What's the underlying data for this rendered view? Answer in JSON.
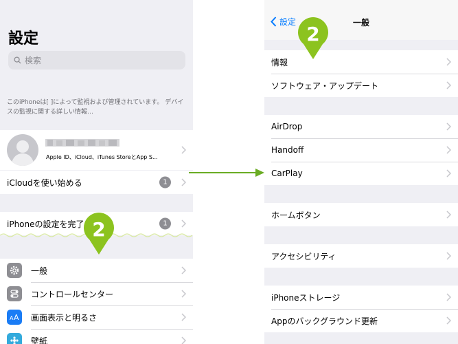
{
  "left": {
    "title": "設定",
    "search_placeholder": "検索",
    "notice": "このiPhoneは[ ]によって監視および管理されています。 デバイスの監視に関する詳しい情報…",
    "profile_subtitle": "Apple ID、iCloud、iTunes StoreとApp S...",
    "icloud_row": {
      "label": "iCloudを使い始める",
      "badge": "1"
    },
    "setup_row": {
      "label": "iPhoneの設定を完了",
      "badge": "1"
    },
    "menu_items": [
      {
        "label": "一般",
        "icon": "gear-icon"
      },
      {
        "label": "コントロールセンター",
        "icon": "control-center-icon"
      },
      {
        "label": "画面表示と明るさ",
        "icon": "display-brightness-icon"
      },
      {
        "label": "壁紙",
        "icon": "wallpaper-icon"
      }
    ]
  },
  "right": {
    "back_label": "設定",
    "title": "一般",
    "groups": [
      [
        "情報",
        "ソフトウェア・アップデート"
      ],
      [
        "AirDrop",
        "Handoff",
        "CarPlay"
      ],
      [
        "ホームボタン"
      ],
      [
        "アクセシビリティ"
      ],
      [
        "iPhoneストレージ",
        "Appのバックグラウンド更新"
      ]
    ]
  },
  "step_badge": "2",
  "colors": {
    "accent": "#007aff",
    "pin": "#8cc31f",
    "arrow": "#6aac24",
    "background": "#efeff4",
    "highlight_line": "#d9e9a4"
  }
}
